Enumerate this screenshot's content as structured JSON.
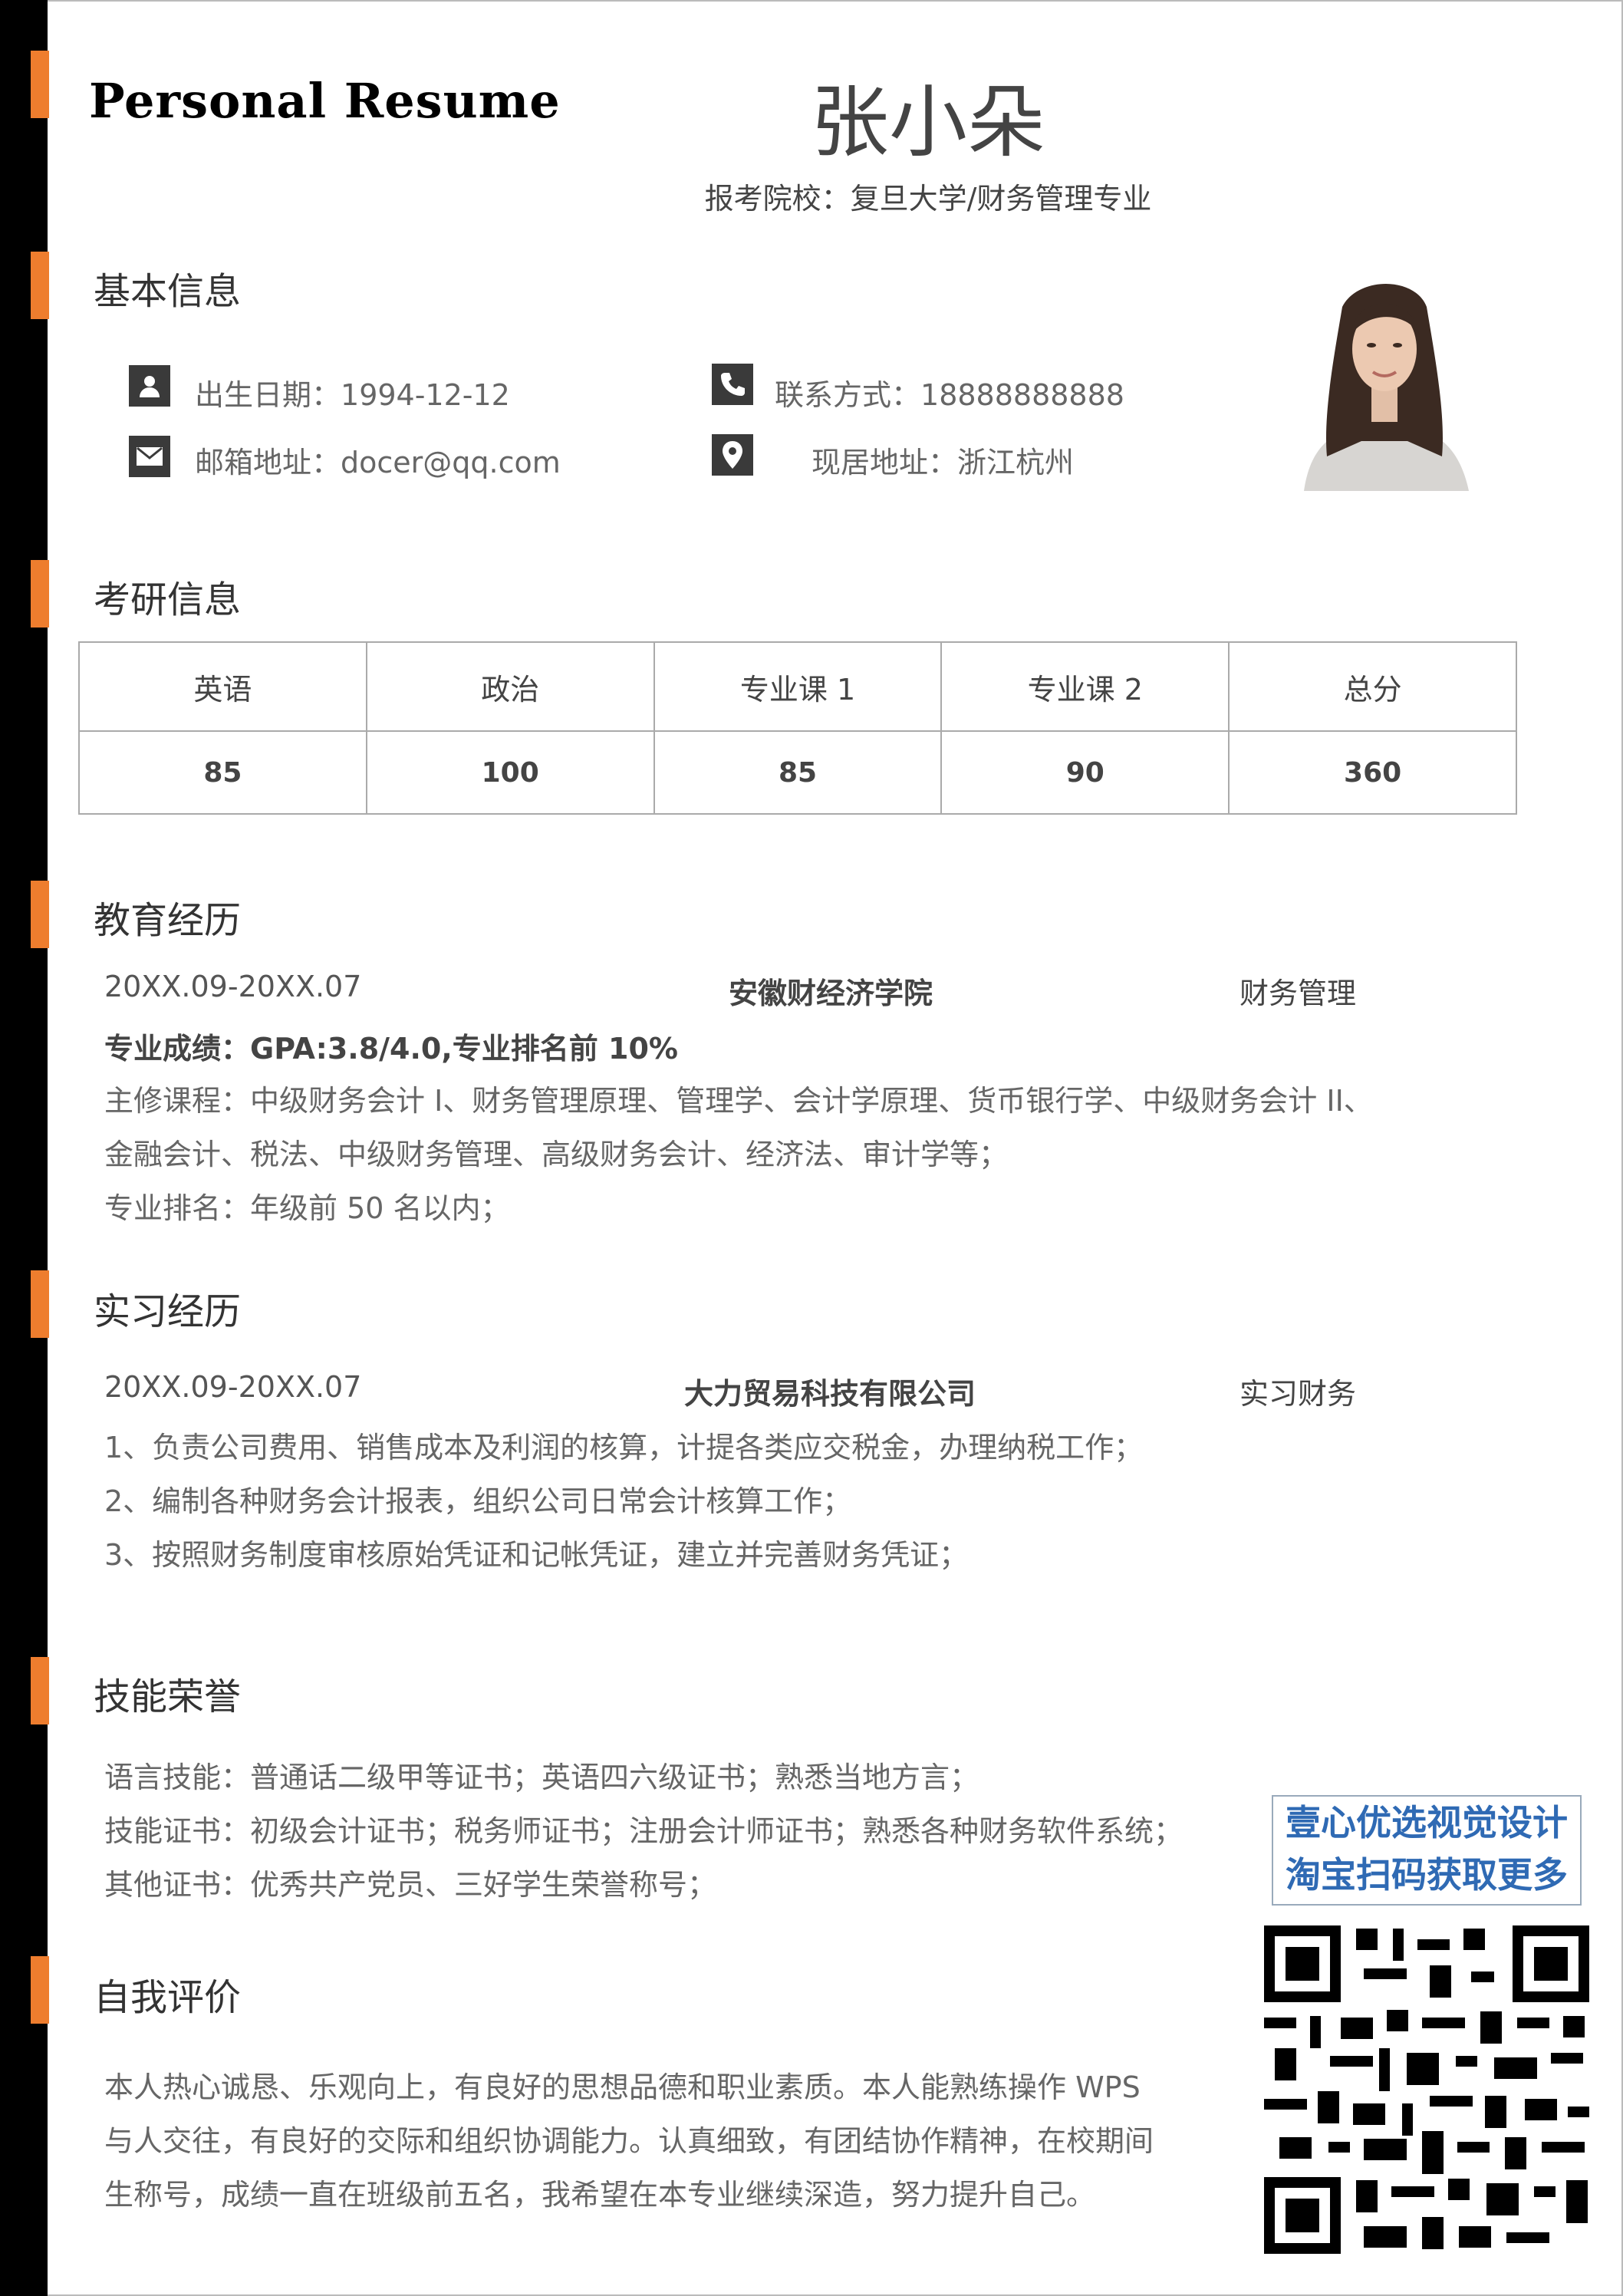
{
  "header": {
    "resume_title": "Personal Resume",
    "name": "张小朵",
    "apply_label": "报考院校：",
    "apply_value": "复旦大学/财务管理专业"
  },
  "basic_info": {
    "title": "基本信息",
    "birth_label": "出生日期：",
    "birth_value": "1994-12-12",
    "contact_label": "联系方式：",
    "contact_value": "18888888888",
    "email_label": "邮箱地址：",
    "email_value": "docer@qq.com",
    "address_label": "现居地址：",
    "address_value": "浙江杭州"
  },
  "exam_info": {
    "title": "考研信息",
    "headers": [
      "英语",
      "政治",
      "专业课 1",
      "专业课 2",
      "总分"
    ],
    "scores": [
      "85",
      "100",
      "85",
      "90",
      "360"
    ]
  },
  "education": {
    "title": "教育经历",
    "period": "20XX.09-20XX.07",
    "school": "安徽财经济学院",
    "major": "财务管理",
    "gpa": "专业成绩：GPA:3.8/4.0,专业排名前 10%",
    "courses_1": "主修课程：中级财务会计 I、财务管理原理、管理学、会计学原理、货币银行学、中级财务会计 II、",
    "courses_2": "金融会计、税法、中级财务管理、高级财务会计、经济法、审计学等；",
    "rank": "专业排名：年级前 50 名以内；"
  },
  "internship": {
    "title": "实习经历",
    "period": "20XX.09-20XX.07",
    "company": "大力贸易科技有限公司",
    "role": "实习财务",
    "items": [
      "1、负责公司费用、销售成本及利润的核算，计提各类应交税金，办理纳税工作；",
      "2、编制各种财务会计报表，组织公司日常会计核算工作；",
      "3、按照财务制度审核原始凭证和记帐凭证，建立并完善财务凭证；"
    ]
  },
  "skills": {
    "title": "技能荣誉",
    "items": [
      "语言技能：普通话二级甲等证书；英语四六级证书；熟悉当地方言；",
      "技能证书：初级会计证书；税务师证书；注册会计师证书；熟悉各种财务软件系统；",
      "其他证书：优秀共产党员、三好学生荣誉称号；"
    ]
  },
  "self_eval": {
    "title": "自我评价",
    "lines": [
      "本人热心诚恳、乐观向上，有良好的思想品德和职业素质。本人能熟练操作 WPS",
      "与人交往，有良好的交际和组织协调能力。认真细致，有团结协作精神，在校期间",
      "生称号，成绩一直在班级前五名，我希望在本专业继续深造，努力提升自己。"
    ]
  },
  "watermark": {
    "line1": "壹心优选视觉设计",
    "line2": "淘宝扫码获取更多"
  },
  "colors": {
    "accent": "#ee7d2e",
    "sidebar": "#000000",
    "watermark_text": "#2f6ab4"
  },
  "icons": [
    "person-icon",
    "phone-icon",
    "mail-icon",
    "location-icon",
    "qr-code-icon"
  ]
}
